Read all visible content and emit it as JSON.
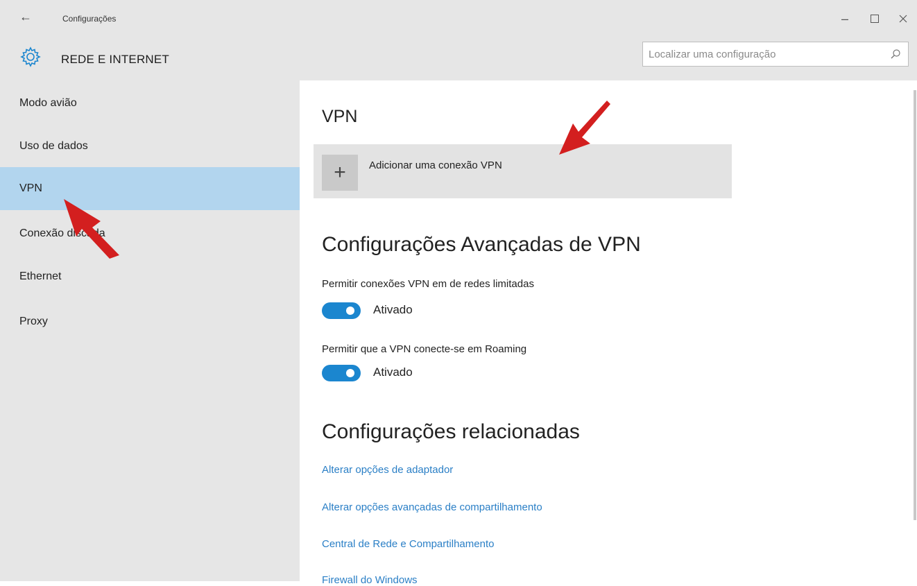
{
  "window": {
    "back_icon": "back-arrow-icon",
    "title": "Configurações",
    "controls": [
      "minimize-icon",
      "maximize-icon",
      "close-icon"
    ]
  },
  "header": {
    "icon": "gear-icon",
    "title": "REDE E INTERNET",
    "search_placeholder": "Localizar uma configuração"
  },
  "sidebar": {
    "items": [
      {
        "label": "Modo avião",
        "active": false
      },
      {
        "label": "Uso de dados",
        "active": false
      },
      {
        "label": "VPN",
        "active": true
      },
      {
        "label": "Conexão discada",
        "active": false
      },
      {
        "label": "Ethernet",
        "active": false
      },
      {
        "label": "Proxy",
        "active": false
      }
    ]
  },
  "main": {
    "heading": "VPN",
    "add_vpn_label": "Adicionar uma conexão VPN",
    "advanced_heading": "Configurações Avançadas de VPN",
    "settings": [
      {
        "label": "Permitir conexões VPN em de redes limitadas",
        "state": "Ativado"
      },
      {
        "label": "Permitir que a VPN conecte-se em Roaming",
        "state": "Ativado"
      }
    ],
    "related_heading": "Configurações relacionadas",
    "links": [
      "Alterar opções de adaptador",
      "Alterar opções avançadas de compartilhamento",
      "Central de Rede e Compartilhamento",
      "Firewall do Windows"
    ]
  },
  "colors": {
    "accent": "#1b86cf",
    "selected_nav": "#b2d5ee",
    "link": "#2a7fc6",
    "annotation_arrow": "#d31f1f"
  }
}
